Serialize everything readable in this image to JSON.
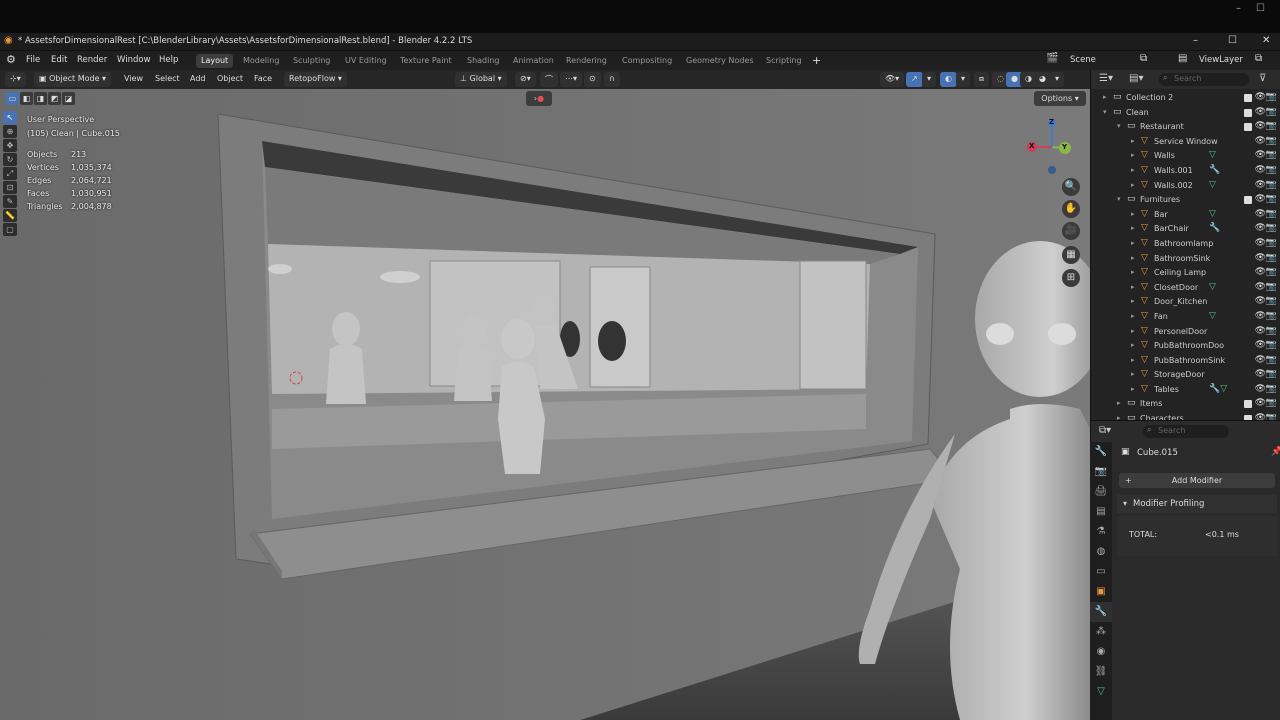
{
  "window": {
    "title": "* AssetsforDimensionalRest [C:\\BlenderLibrary\\Assets\\AssetsforDimensionalRest.blend] - Blender 4.2.2 LTS",
    "minimize": "–",
    "maximize": "☐",
    "close": "✕"
  },
  "menu": {
    "items": [
      "File",
      "Edit",
      "Render",
      "Window",
      "Help"
    ],
    "workspaces": [
      "Layout",
      "Modeling",
      "Sculpting",
      "UV Editing",
      "Texture Paint",
      "Shading",
      "Animation",
      "Rendering",
      "Compositing",
      "Geometry Nodes",
      "Scripting"
    ],
    "active_workspace": "Layout",
    "add_tab": "+",
    "scene": "Scene",
    "view_layer": "ViewLayer"
  },
  "header": {
    "mode": "Object Mode",
    "view": "View",
    "select": "Select",
    "add": "Add",
    "object": "Object",
    "face": "Face",
    "addon": "RetopoFlow",
    "transform": "Global",
    "options": "Options"
  },
  "viewport": {
    "perspective": "User Perspective",
    "context": "(105) Clean | Cube.015",
    "stats": [
      {
        "label": "Objects",
        "value": "213"
      },
      {
        "label": "Vertices",
        "value": "1,035,374"
      },
      {
        "label": "Edges",
        "value": "2,064,721"
      },
      {
        "label": "Faces",
        "value": "1,030,951"
      },
      {
        "label": "Triangles",
        "value": "2,004,878"
      }
    ],
    "gizmo": {
      "x": "X",
      "y": "Y",
      "z": "Z"
    }
  },
  "outliner": {
    "search_placeholder": "Search",
    "rows": [
      {
        "label": "Collection 2",
        "indent": 1,
        "type": "collection",
        "tri": "▸"
      },
      {
        "label": "Clean",
        "indent": 1,
        "type": "collection",
        "tri": "▾"
      },
      {
        "label": "Restaurant",
        "indent": 2,
        "type": "collection",
        "tri": "▾"
      },
      {
        "label": "Service Window",
        "indent": 3,
        "type": "object",
        "tri": "▸"
      },
      {
        "label": "Walls",
        "indent": 3,
        "type": "object",
        "tri": "▸",
        "extra": "▽"
      },
      {
        "label": "Walls.001",
        "indent": 3,
        "type": "object",
        "tri": "▸",
        "extra": "🔧"
      },
      {
        "label": "Walls.002",
        "indent": 3,
        "type": "object",
        "tri": "▸",
        "extra": "▽"
      },
      {
        "label": "Furnitures",
        "indent": 2,
        "type": "collection",
        "tri": "▾"
      },
      {
        "label": "Bar",
        "indent": 3,
        "type": "object",
        "tri": "▸",
        "extra": "▽"
      },
      {
        "label": "BarChair",
        "indent": 3,
        "type": "object",
        "tri": "▸",
        "extra": "🔧"
      },
      {
        "label": "Bathroomlamp",
        "indent": 3,
        "type": "object",
        "tri": "▸"
      },
      {
        "label": "BathroomSink",
        "indent": 3,
        "type": "object",
        "tri": "▸"
      },
      {
        "label": "Ceiling Lamp",
        "indent": 3,
        "type": "object",
        "tri": "▸"
      },
      {
        "label": "ClosetDoor",
        "indent": 3,
        "type": "object",
        "tri": "▸",
        "extra": "▽"
      },
      {
        "label": "Door_Kitchen",
        "indent": 3,
        "type": "object",
        "tri": "▸"
      },
      {
        "label": "Fan",
        "indent": 3,
        "type": "object",
        "tri": "▸",
        "extra": "▽"
      },
      {
        "label": "PersonelDoor",
        "indent": 3,
        "type": "object",
        "tri": "▸"
      },
      {
        "label": "PubBathroomDoo",
        "indent": 3,
        "type": "object",
        "tri": "▸"
      },
      {
        "label": "PubBathroomSink",
        "indent": 3,
        "type": "object",
        "tri": "▸"
      },
      {
        "label": "StorageDoor",
        "indent": 3,
        "type": "object",
        "tri": "▸"
      },
      {
        "label": "Tables",
        "indent": 3,
        "type": "object",
        "tri": "▸",
        "extra": "🔧▽"
      },
      {
        "label": "Items",
        "indent": 2,
        "type": "collection",
        "tri": "▸"
      },
      {
        "label": "Characters",
        "indent": 2,
        "type": "collection",
        "tri": "▸"
      }
    ]
  },
  "properties": {
    "search_placeholder": "Search",
    "object_name": "Cube.015",
    "add_modifier": "Add Modifier",
    "panel_title": "Modifier Profiling",
    "total_label": "TOTAL:",
    "total_value": "<0.1 ms"
  },
  "colors": {
    "accent": "#4772b3",
    "collection_icon": "#dddddd",
    "object_icon": "#e89a3c",
    "viewport_bg": "#6e6e6e"
  }
}
